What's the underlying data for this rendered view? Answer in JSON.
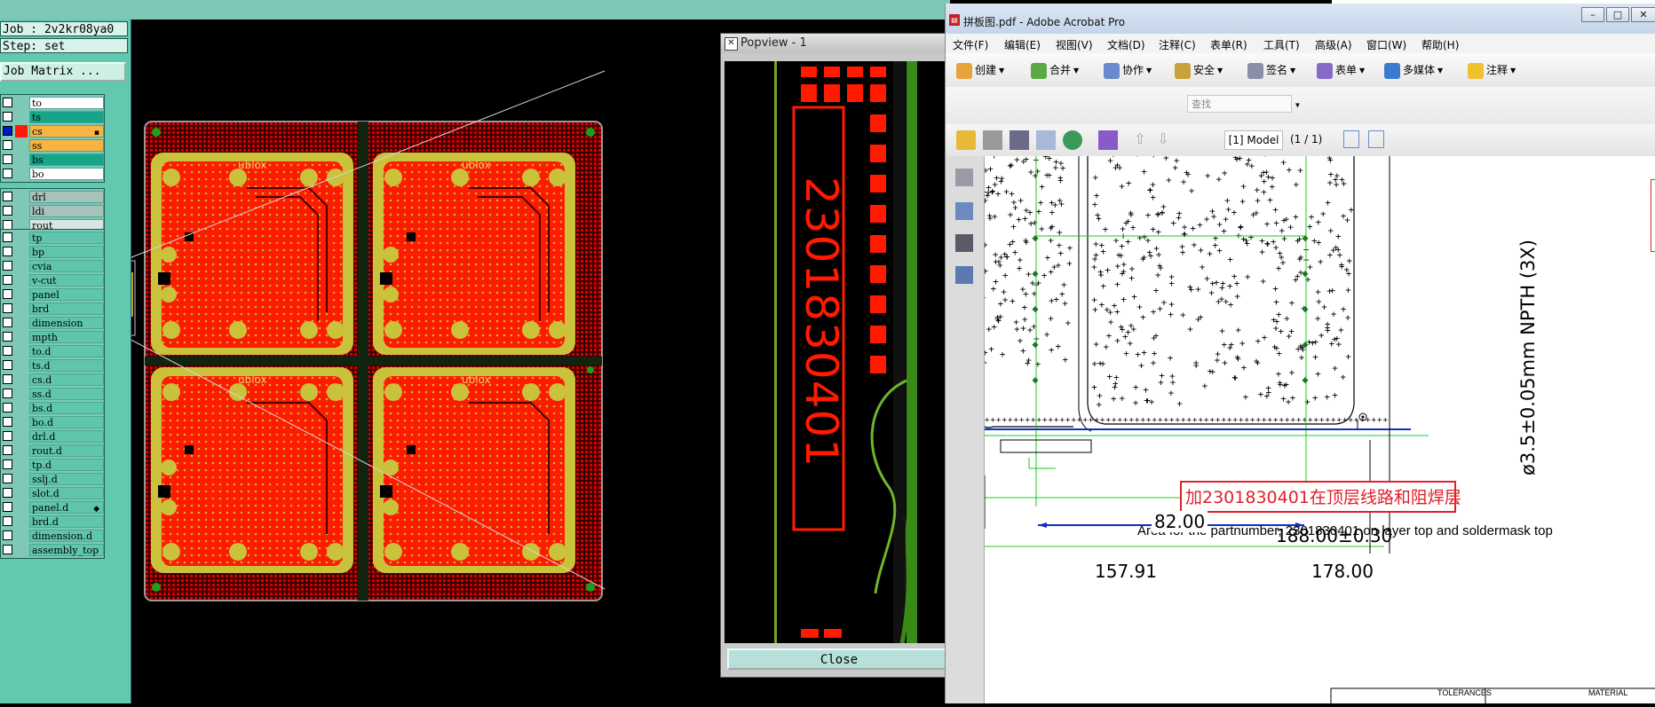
{
  "cam": {
    "job_label": "Job : 2v2kr08ya0",
    "step_label": "Step: set",
    "job_matrix_button": "Job Matrix ...",
    "layers_board": [
      {
        "name": "to",
        "color": "white",
        "checked": false
      },
      {
        "name": "ts",
        "color": "teal",
        "checked": false
      },
      {
        "name": "cs",
        "color": "orange",
        "checked": true,
        "mark": "▪"
      },
      {
        "name": "ss",
        "color": "orange",
        "checked": false
      },
      {
        "name": "bs",
        "color": "teal",
        "checked": false
      },
      {
        "name": "bo",
        "color": "white",
        "checked": false
      }
    ],
    "layers_drill": [
      {
        "name": "drl",
        "color": "grey"
      },
      {
        "name": "ldi",
        "color": "grey"
      },
      {
        "name": "rout",
        "color": "light"
      }
    ],
    "layers_misc": [
      {
        "name": "tp"
      },
      {
        "name": "bp"
      },
      {
        "name": "cvia"
      },
      {
        "name": "v-cut"
      },
      {
        "name": "panel"
      },
      {
        "name": "brd"
      },
      {
        "name": "dimension"
      },
      {
        "name": "mpth"
      },
      {
        "name": "to.d"
      },
      {
        "name": "ts.d"
      },
      {
        "name": "cs.d"
      },
      {
        "name": "ss.d"
      },
      {
        "name": "bs.d"
      },
      {
        "name": "bo.d"
      },
      {
        "name": "drl.d"
      },
      {
        "name": "rout.d"
      },
      {
        "name": "tp.d"
      },
      {
        "name": "sslj.d"
      },
      {
        "name": "slot.d"
      },
      {
        "name": "panel.d",
        "mark": "◆"
      },
      {
        "name": "brd.d"
      },
      {
        "name": "dimension.d"
      },
      {
        "name": "assembly_top"
      }
    ],
    "board_text": "ublox",
    "accent_red": "#ff1a00",
    "accent_olive": "#c9c23a"
  },
  "popview": {
    "title": "Popview - 1",
    "part_number": "2301830401",
    "close_label": "Close"
  },
  "acrobat": {
    "window_title": "拼板图.pdf - Adobe Acrobat Pro",
    "menu": [
      "文件(F)",
      "编辑(E)",
      "视图(V)",
      "文档(D)",
      "注释(C)",
      "表单(R)",
      "工具(T)",
      "高级(A)",
      "窗口(W)",
      "帮助(H)"
    ],
    "tools": [
      "创建",
      "合并",
      "协作",
      "安全",
      "签名",
      "表单",
      "多媒体",
      "注释"
    ],
    "search_placeholder": "查找",
    "page_label": "[1] Model",
    "page_count": "(1 / 1)",
    "callout_text": "加2301830401在顶层线路和阻焊层",
    "area_note": "Area for the partnumber, 2301830401 on layer top and soldermask top",
    "dim_157": "157.91",
    "dim_178": "178.00",
    "dim_82": "82.00",
    "dim_188": "188.00±0.30",
    "npth_note": "ø3.5±0.05mm NPTH (3X)",
    "tolerances": "TOLERANCES",
    "material": "MATERIAL"
  }
}
